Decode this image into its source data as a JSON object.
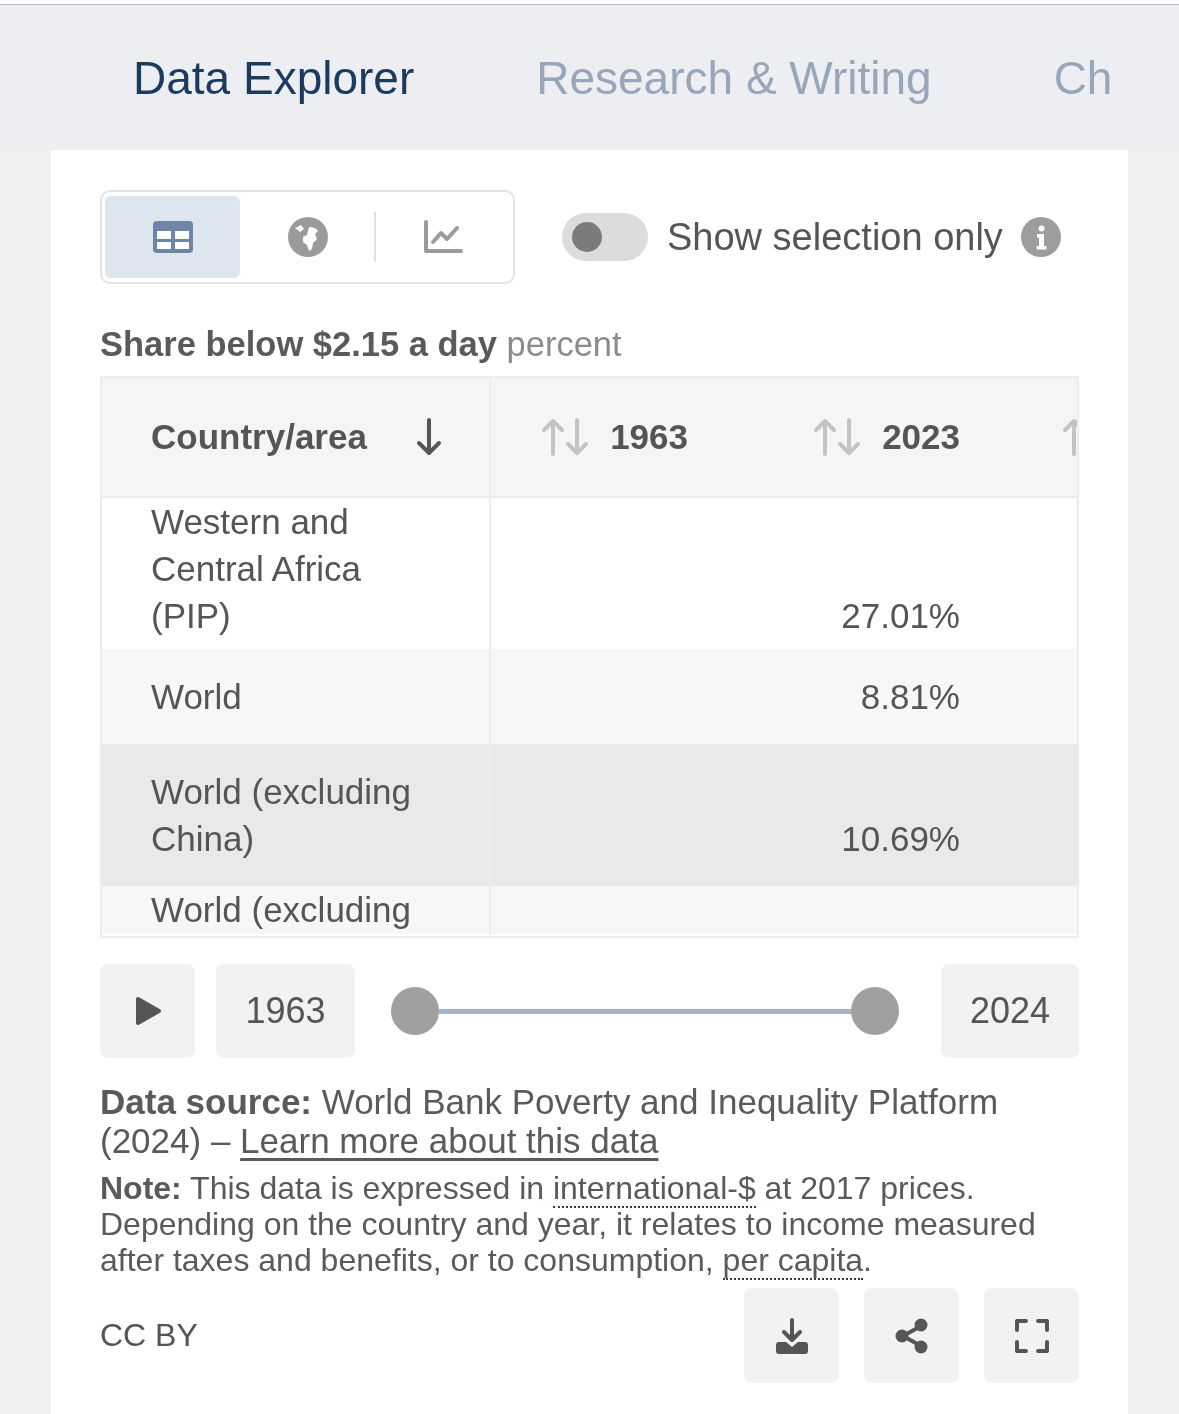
{
  "tabs": [
    {
      "label": "Data Explorer",
      "selected": true
    },
    {
      "label": "Research & Writing",
      "selected": false
    },
    {
      "label": "Ch",
      "selected": false
    }
  ],
  "view_switcher": [
    {
      "kind": "table",
      "selected": true
    },
    {
      "kind": "map",
      "selected": false
    },
    {
      "kind": "chart",
      "selected": false
    }
  ],
  "selection_toggle": {
    "label": "Show selection only",
    "on": false
  },
  "table": {
    "title": "Share below $2.15 a day",
    "unit": "percent",
    "columns": [
      {
        "label": "Country/area",
        "sorted": true
      },
      {
        "label": "1963",
        "sorted": false
      },
      {
        "label": "2023",
        "sorted": false
      },
      {
        "sorted": false
      }
    ],
    "rows": [
      {
        "country": "Western and Central Africa (PIP)",
        "value_2023": "27.01%",
        "highlighted": false
      },
      {
        "country": "World",
        "value_2023": "8.81%",
        "highlighted": false
      },
      {
        "country": "World (excluding China)",
        "value_2023": "10.69%",
        "highlighted": true
      },
      {
        "country": "World (excluding",
        "highlighted": false
      }
    ]
  },
  "timeline": {
    "playing": false,
    "start": "1963",
    "end": "2024",
    "thumbs": [
      {
        "level": 0
      },
      {
        "level": 1
      }
    ]
  },
  "source": [
    {
      "kind": "text",
      "text": "**Data source:** World Bank Poverty and Inequality Platform (2024) – "
    },
    {
      "kind": "link",
      "text": "Learn more about this data"
    }
  ],
  "note": [
    {
      "kind": "text",
      "text": "**Note:** This data is expressed in "
    },
    {
      "kind": "term",
      "text": "international-$"
    },
    {
      "kind": "text",
      "text": " at 2017 prices. Depending on the country and year, it relates to income measured after taxes and benefits, or to consumption, "
    },
    {
      "kind": "term",
      "text": "per capita"
    },
    {
      "kind": "text",
      "text": "."
    }
  ],
  "license": "CC BY",
  "actions": [
    {
      "kind": "download"
    },
    {
      "kind": "share"
    },
    {
      "kind": "fullscreen"
    }
  ]
}
